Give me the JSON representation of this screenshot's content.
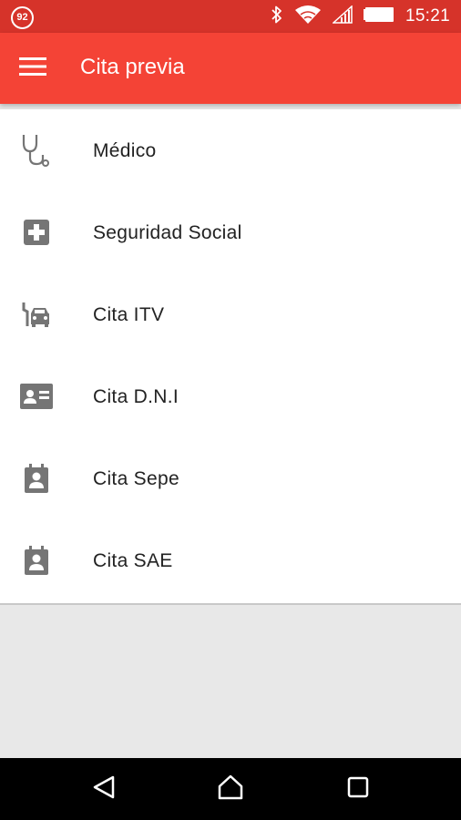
{
  "status_bar": {
    "notification_badge": "92",
    "time": "15:21",
    "icons": [
      "bluetooth-icon",
      "wifi-icon",
      "signal-icon",
      "battery-icon"
    ]
  },
  "app_bar": {
    "title": "Cita previa",
    "menu_icon": "hamburger-menu-icon"
  },
  "menu": {
    "items": [
      {
        "label": "Médico",
        "icon": "stethoscope-icon"
      },
      {
        "label": "Seguridad Social",
        "icon": "medical-cross-icon"
      },
      {
        "label": "Cita ITV",
        "icon": "car-repair-icon"
      },
      {
        "label": "Cita D.N.I",
        "icon": "id-card-icon"
      },
      {
        "label": "Cita Sepe",
        "icon": "contact-calendar-icon"
      },
      {
        "label": "Cita SAE",
        "icon": "contact-calendar-icon"
      }
    ]
  },
  "nav_bar": {
    "buttons": [
      "back-icon",
      "home-icon",
      "recents-icon"
    ]
  },
  "colors": {
    "status_bar": "#d6332a",
    "app_bar": "#f44336",
    "icon_gray": "#757575",
    "background": "#e8e8e8"
  }
}
